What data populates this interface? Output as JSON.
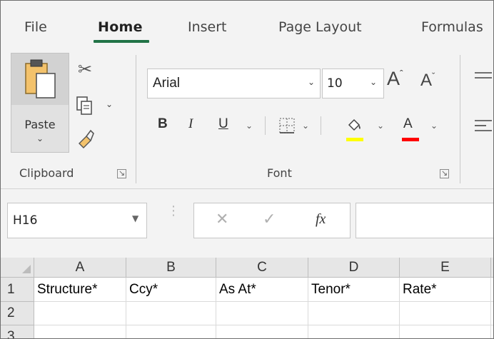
{
  "tabs": [
    {
      "label": "File"
    },
    {
      "label": "Home"
    },
    {
      "label": "Insert"
    },
    {
      "label": "Page Layout"
    },
    {
      "label": "Formulas"
    }
  ],
  "active_tab": "Home",
  "ribbon": {
    "clipboard": {
      "paste_label": "Paste",
      "group_label": "Clipboard",
      "icons": [
        "paste-icon",
        "cut-icon",
        "copy-icon",
        "format-painter-icon",
        "dialog-launcher-icon"
      ]
    },
    "font": {
      "font_name": "Arial",
      "font_size": "10",
      "bold_label": "B",
      "italic_label": "I",
      "underline_label": "U",
      "font_color_label": "A",
      "group_label": "Font",
      "highlight_color": "#ffff00",
      "font_color": "#ff0000",
      "icons": [
        "increase-font-size-icon",
        "decrease-font-size-icon",
        "borders-icon",
        "fill-color-icon",
        "font-color-icon",
        "dialog-launcher-icon"
      ]
    },
    "alignment": {
      "icons": [
        "align-top-icon",
        "align-left-icon"
      ]
    }
  },
  "formula_bar": {
    "name_box": "H16",
    "fx_label": "fx",
    "formula": ""
  },
  "sheet": {
    "columns": [
      "A",
      "B",
      "C",
      "D",
      "E"
    ],
    "rows": [
      {
        "number": "1",
        "cells": [
          "Structure*",
          "Ccy*",
          "As At*",
          "Tenor*",
          "Rate*"
        ]
      },
      {
        "number": "2",
        "cells": [
          "",
          "",
          "",
          "",
          ""
        ]
      },
      {
        "number": "3",
        "cells": [
          "",
          "",
          "",
          "",
          ""
        ]
      }
    ]
  },
  "colors": {
    "accent": "#217346",
    "ribbon_bg": "#f3f3f3",
    "header_bg": "#e6e6e6"
  }
}
